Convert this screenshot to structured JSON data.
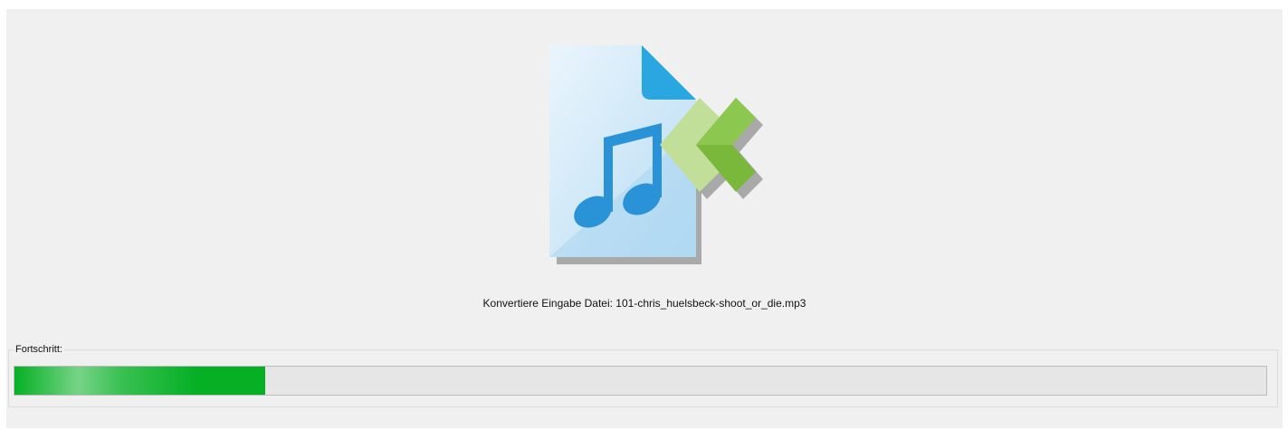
{
  "status": {
    "text": "Konvertiere Eingabe Datei: 101-chris_huelsbeck-shoot_or_die.mp3"
  },
  "progress": {
    "label": "Fortschritt:",
    "fraction": 0.2
  },
  "icons": {
    "main": "audio-file-convert-icon"
  },
  "colors": {
    "background": "#f0f0f0",
    "progress_fill": "#06b025",
    "progress_track": "#e6e6e6",
    "file_light": "#e3f1fb",
    "file_corner": "#2aa6e0",
    "note": "#2a93d8",
    "arrow_light": "#c2df9a",
    "arrow_dark": "#7ab83c"
  }
}
